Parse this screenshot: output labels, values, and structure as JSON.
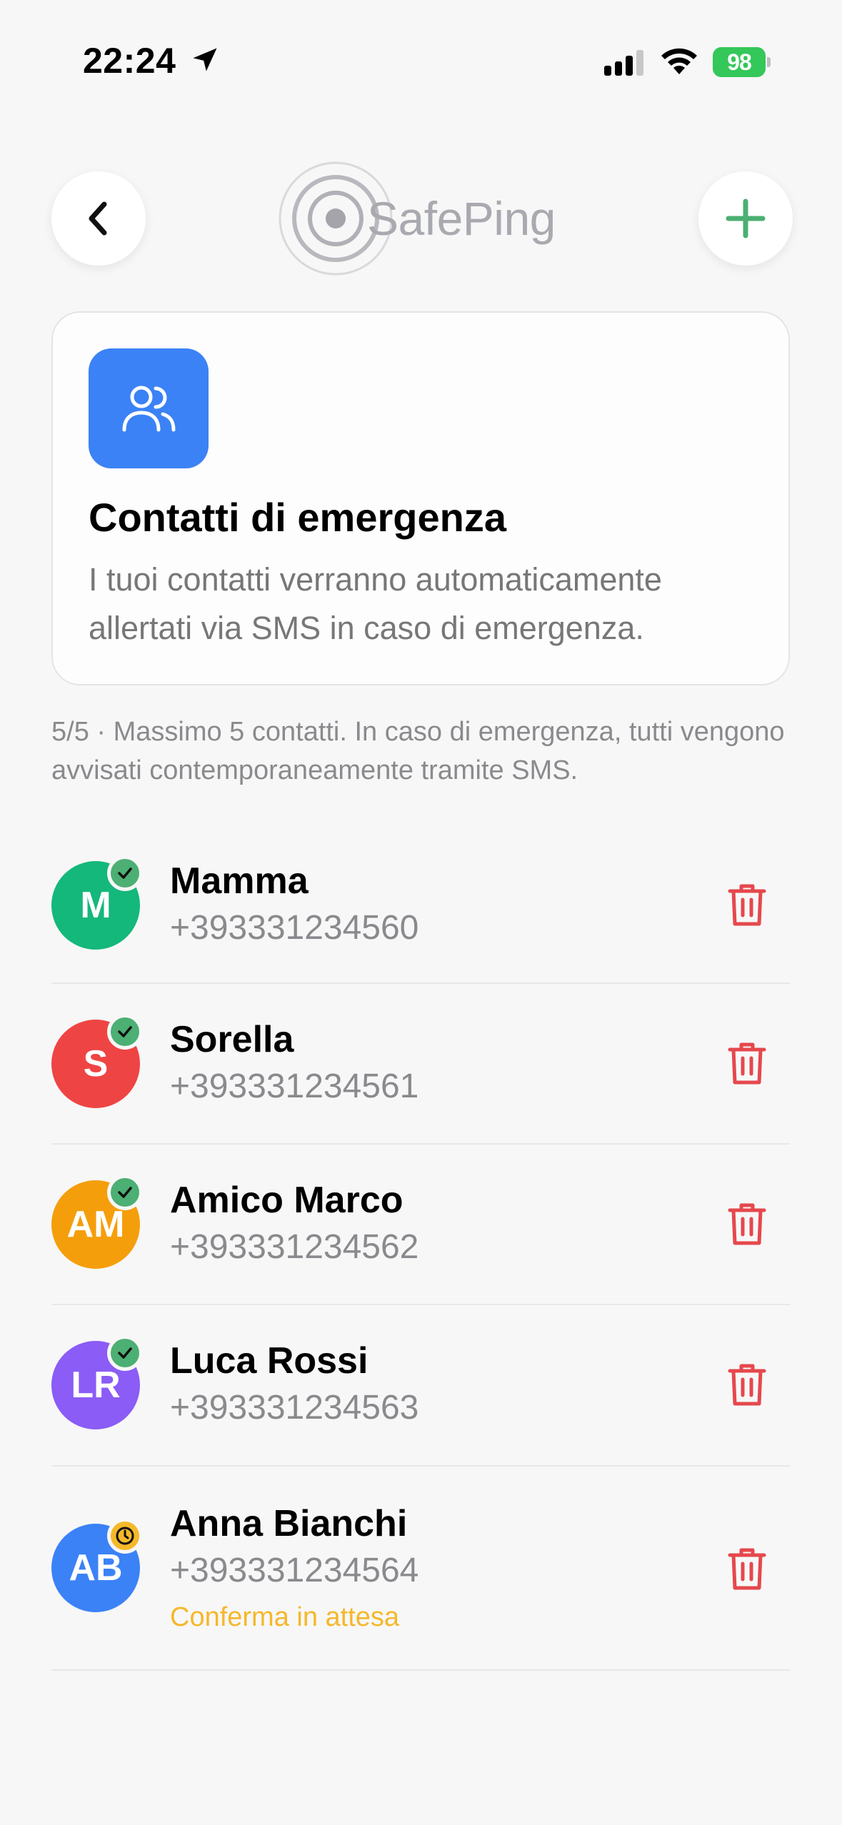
{
  "status_bar": {
    "time": "22:24",
    "battery": "98"
  },
  "header": {
    "logo_text": "SafePing"
  },
  "info_card": {
    "title": "Contatti di emergenza",
    "description": "I tuoi contatti verranno automaticamente allertati via SMS in caso di emergenza."
  },
  "limit_note": "5/5 · Massimo 5 contatti. In caso di emergenza, tutti vengono avvisati contemporaneamente tramite SMS.",
  "contacts": [
    {
      "initials": "M",
      "name": "Mamma",
      "phone": "+393331234560",
      "color": "#14b87a",
      "status": "confirmed"
    },
    {
      "initials": "S",
      "name": "Sorella",
      "phone": "+393331234561",
      "color": "#ef4444",
      "status": "confirmed"
    },
    {
      "initials": "AM",
      "name": "Amico Marco",
      "phone": "+393331234562",
      "color": "#f59e0b",
      "status": "confirmed"
    },
    {
      "initials": "LR",
      "name": "Luca Rossi",
      "phone": "+393331234563",
      "color": "#8b5cf6",
      "status": "confirmed"
    },
    {
      "initials": "AB",
      "name": "Anna Bianchi",
      "phone": "+393331234564",
      "color": "#3b82f6",
      "status": "pending",
      "status_label": "Conferma in attesa"
    }
  ],
  "colors": {
    "accent_green": "#4caf73",
    "pending_yellow": "#f5b82a",
    "delete_red": "#e5484d",
    "info_blue": "#3b82f6"
  }
}
